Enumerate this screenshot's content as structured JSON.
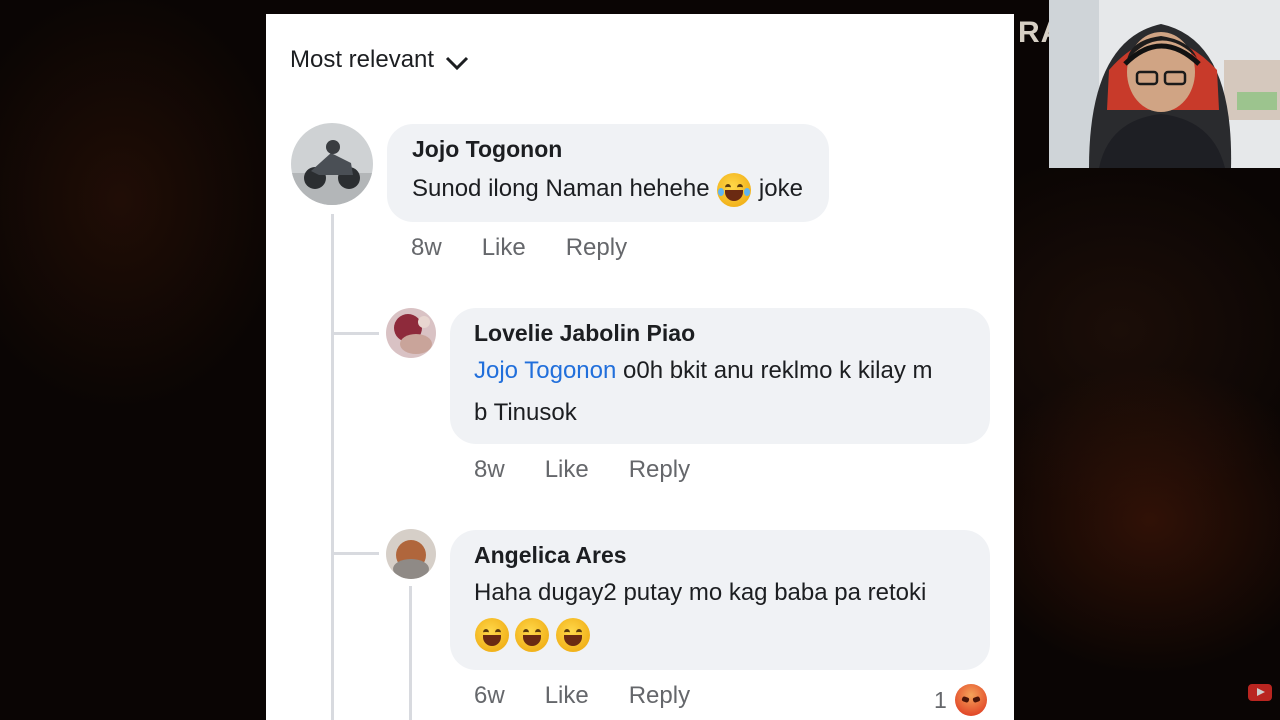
{
  "overlay": {
    "brand_fragment": "RA"
  },
  "sort": {
    "label": "Most relevant",
    "icon": "chevron-down-icon"
  },
  "comments": [
    {
      "author": "Jojo Togonon",
      "text": "Sunod ilong Naman hehehe",
      "emoji": "tears-of-joy-emoji",
      "text_after": "joke",
      "time": "8w",
      "like": "Like",
      "reply": "Reply"
    },
    {
      "author": "Lovelie Jabolin Piao",
      "mention": "Jojo Togonon",
      "text_line1": "o0h bkit anu reklmo k kilay m",
      "text_line2": "b Tinusok",
      "time": "8w",
      "like": "Like",
      "reply": "Reply"
    },
    {
      "author": "Angelica Ares",
      "text": "Haha dugay2 putay mo kag baba pa retoki",
      "emojis": [
        "laughing-emoji",
        "laughing-emoji",
        "laughing-emoji"
      ],
      "time": "6w",
      "like": "Like",
      "reply": "Reply",
      "reaction_count": "1",
      "reaction_icon": "angry-reaction-icon"
    }
  ],
  "colors": {
    "mention": "#216fdb",
    "bubble": "#f0f2f5",
    "meta": "#65676b"
  }
}
